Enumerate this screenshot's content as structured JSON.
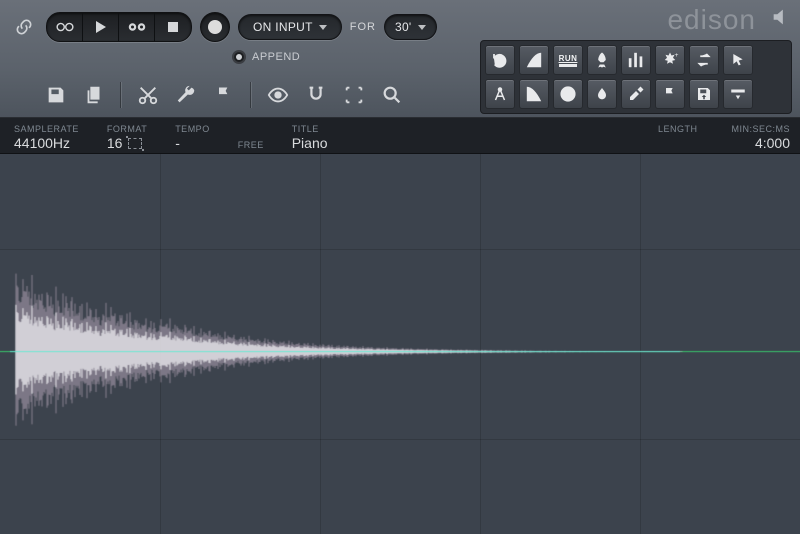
{
  "brand": "edison",
  "transport": {
    "on_input_label": "ON INPUT",
    "for_label": "FOR",
    "duration_label": "30'",
    "append_label": "APPEND"
  },
  "info": {
    "samplerate_label": "SAMPLERATE",
    "samplerate_value": "44100Hz",
    "format_label": "FORMAT",
    "format_value": "16",
    "tempo_label": "TEMPO",
    "tempo_value": "-",
    "free_label": "FREE",
    "free_value": "",
    "title_label": "TITLE",
    "title_value": "Piano",
    "length_label": "LENGTH",
    "length_value": "",
    "minsecms_label": "MIN:SEC:MS",
    "minsecms_value": "4:000"
  },
  "toolpanel": {
    "row1": [
      "undo",
      "fade-in",
      "run-script",
      "rocket",
      "eq",
      "tune",
      "swap",
      "cursor"
    ],
    "row2": [
      "compass",
      "fade-out",
      "clock",
      "drop",
      "brush",
      "marker",
      "save",
      "drag-to-track"
    ],
    "run_label": "RUN"
  }
}
